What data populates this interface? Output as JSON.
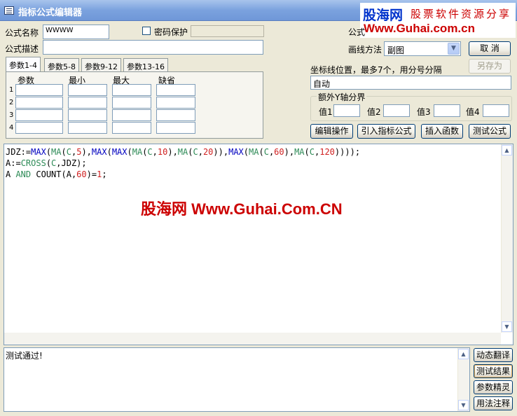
{
  "window": {
    "title": "指标公式编辑器"
  },
  "brand": {
    "name": "股海网",
    "tagline": "股票软件资源分享",
    "url": "Www.Guhai.com.cn"
  },
  "form": {
    "name_label": "公式名称",
    "name_value": "WWWW",
    "password_label": "密码保护",
    "desc_label": "公式描述",
    "desc_value": "",
    "type_label_partial": "公式",
    "draw_method_label": "画线方法",
    "draw_method_value": "副图",
    "cancel_label": "取  消",
    "save_as_label": "另存为"
  },
  "params": {
    "tabs": [
      "参数1-4",
      "参数5-8",
      "参数9-12",
      "参数13-16"
    ],
    "columns": [
      "参数",
      "最小",
      "最大",
      "缺省"
    ],
    "rows": [
      "1",
      "2",
      "3",
      "4"
    ]
  },
  "axis": {
    "label": "坐标线位置，最多7个，用分号分隔",
    "value": "自动",
    "extra_group_title": "额外Y轴分界",
    "value_labels": [
      "值1",
      "值2",
      "值3",
      "值4"
    ]
  },
  "actions": [
    "编辑操作",
    "引入指标公式",
    "插入函数",
    "测试公式"
  ],
  "editor": {
    "watermark": "股海网 Www.Guhai.Com.CN",
    "lines": [
      [
        [
          "JDZ:=",
          ""
        ],
        [
          "MAX",
          "kw"
        ],
        [
          "(",
          ""
        ],
        [
          "MA",
          "fn"
        ],
        [
          "(",
          ""
        ],
        [
          "C",
          "fn"
        ],
        [
          ",",
          ""
        ],
        [
          "5",
          "num"
        ],
        [
          "),",
          ""
        ],
        [
          "MAX",
          "kw"
        ],
        [
          "(",
          ""
        ],
        [
          "MAX",
          "kw"
        ],
        [
          "(",
          ""
        ],
        [
          "MA",
          "fn"
        ],
        [
          "(",
          ""
        ],
        [
          "C",
          "fn"
        ],
        [
          ",",
          ""
        ],
        [
          "10",
          "num"
        ],
        [
          "),",
          ""
        ],
        [
          "MA",
          "fn"
        ],
        [
          "(",
          ""
        ],
        [
          "C",
          "fn"
        ],
        [
          ",",
          ""
        ],
        [
          "20",
          "num"
        ],
        [
          ")),",
          ""
        ],
        [
          "MAX",
          "kw"
        ],
        [
          "(",
          ""
        ],
        [
          "MA",
          "fn"
        ],
        [
          "(",
          ""
        ],
        [
          "C",
          "fn"
        ],
        [
          ",",
          ""
        ],
        [
          "60",
          "num"
        ],
        [
          "),",
          ""
        ],
        [
          "MA",
          "fn"
        ],
        [
          "(",
          ""
        ],
        [
          "C",
          "fn"
        ],
        [
          ",",
          ""
        ],
        [
          "120",
          "num"
        ],
        [
          "))));",
          ""
        ]
      ],
      [
        [
          "A:=",
          ""
        ],
        [
          "CROSS",
          "fn"
        ],
        [
          "(",
          ""
        ],
        [
          "C",
          "fn"
        ],
        [
          ",JDZ);",
          ""
        ]
      ],
      [
        [
          "A ",
          ""
        ],
        [
          "AND",
          "fn"
        ],
        [
          " COUNT(A,",
          ""
        ],
        [
          "60",
          "num"
        ],
        [
          ")=",
          ""
        ],
        [
          "1",
          "num"
        ],
        [
          ";",
          ""
        ]
      ]
    ]
  },
  "output": {
    "text": "测试通过!"
  },
  "side_buttons": [
    "动态翻译",
    "测试结果",
    "参数精灵",
    "用法注释"
  ]
}
